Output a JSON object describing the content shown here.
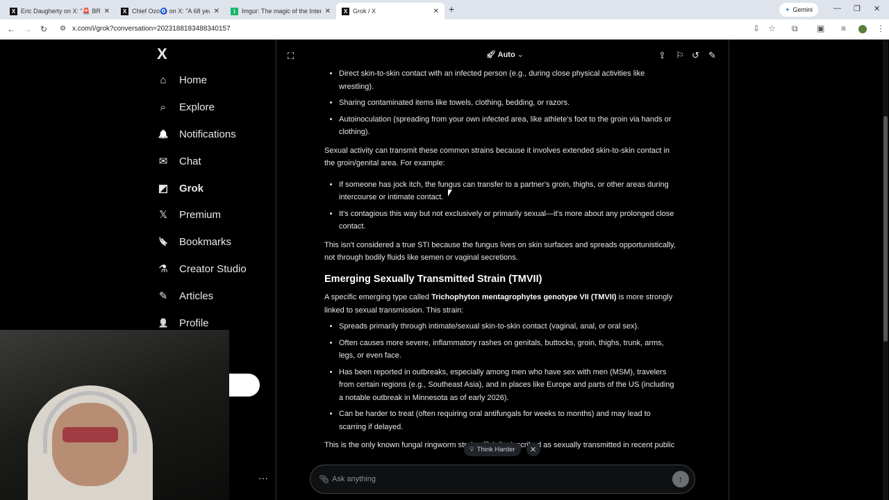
{
  "browser": {
    "tabs": [
      {
        "title": "Eric Daugherty on X: \"🚨 BREAK",
        "icon": "x-icon"
      },
      {
        "title": "Chief Ozo🧿 on X: \"A 68 year o",
        "icon": "x-icon"
      },
      {
        "title": "Imgur: The magic of the Interne",
        "icon": "imgur-icon"
      },
      {
        "title": "Grok / X",
        "icon": "x-icon"
      }
    ],
    "gemini_label": "Gemini",
    "url": "x.com/i/grok?conversation=2023188183488340157"
  },
  "sidebar": {
    "logo": "X",
    "items": [
      {
        "label": "Home",
        "icon": "home-icon",
        "glyph": "⌂"
      },
      {
        "label": "Explore",
        "icon": "search-icon",
        "glyph": "⌕"
      },
      {
        "label": "Notifications",
        "icon": "bell-icon",
        "glyph": "🔔"
      },
      {
        "label": "Chat",
        "icon": "mail-icon",
        "glyph": "✉"
      },
      {
        "label": "Grok",
        "icon": "grok-icon",
        "glyph": "◩"
      },
      {
        "label": "Premium",
        "icon": "x-premium-icon",
        "glyph": "𝕏"
      },
      {
        "label": "Bookmarks",
        "icon": "bookmark-icon",
        "glyph": "🔖"
      },
      {
        "label": "Creator Studio",
        "icon": "flask-icon",
        "glyph": "⚗"
      },
      {
        "label": "Articles",
        "icon": "article-icon",
        "glyph": "✎"
      },
      {
        "label": "Profile",
        "icon": "person-icon",
        "glyph": "👤"
      }
    ]
  },
  "header": {
    "mode": "Auto"
  },
  "content": {
    "list1": [
      "Direct skin-to-skin contact with an infected person (e.g., during close physical activities like wrestling).",
      "Sharing contaminated items like towels, clothing, bedding, or razors.",
      "Autoinoculation (spreading from your own infected area, like athlete's foot to the groin via hands or clothing)."
    ],
    "para1": "Sexual activity can transmit these common strains because it involves extended skin-to-skin contact in the groin/genital area. For example:",
    "list2": [
      "If someone has jock itch, the fungus can transfer to a partner's groin, thighs, or other areas during intercourse or intimate contact.",
      "It's contagious this way but not exclusively or primarily sexual—it's more about any prolonged close contact."
    ],
    "para2": "This isn't considered a true STI because the fungus lives on skin surfaces and spreads opportunistically, not through bodily fluids like semen or vaginal secretions.",
    "heading": "Emerging Sexually Transmitted Strain (TMVII)",
    "para3_pre": "A specific emerging type called ",
    "para3_bold": "Trichophyton mentagrophytes genotype VII (TMVII)",
    "para3_post": " is more strongly linked to sexual transmission. This strain:",
    "list3": [
      "Spreads primarily through intimate/sexual skin-to-skin contact (vaginal, anal, or oral sex).",
      "Often causes more severe, inflammatory rashes on genitals, buttocks, groin, thighs, trunk, arms, legs, or even face.",
      "Has been reported in outbreaks, especially among men who have sex with men (MSM), travelers from certain regions (e.g., Southeast Asia), and in places like Europe and parts of the US (including a notable outbreak in Minnesota as of early 2026).",
      "Can be harder to treat (often requiring oral antifungals for weeks to months) and may lead to scarring if delayed."
    ],
    "para4": "This is the only known fungal ringworm strain officially described as sexually transmitted in recent public"
  },
  "composer": {
    "think_harder": "Think Harder",
    "placeholder": "Ask anything"
  }
}
